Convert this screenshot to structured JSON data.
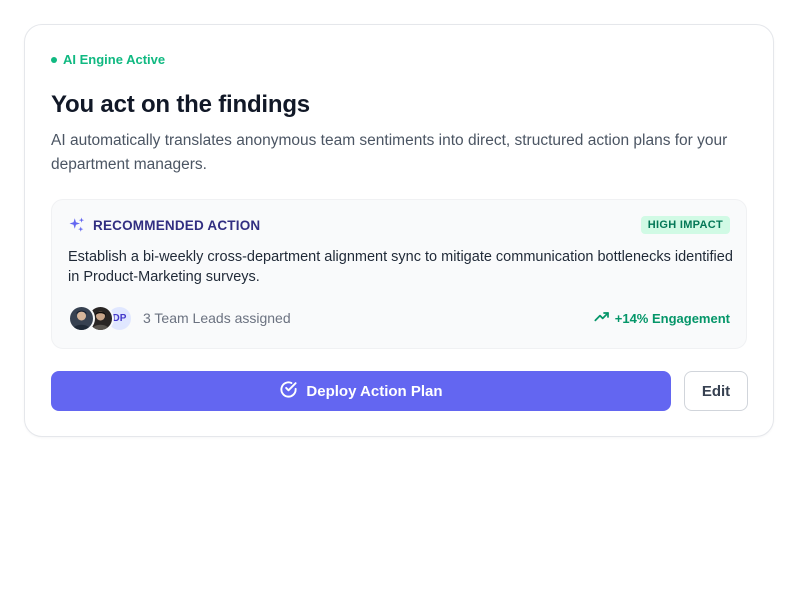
{
  "status": {
    "label": "AI Engine Active",
    "color": "#10b981"
  },
  "heading": {
    "title": "You act on the findings",
    "description": "AI automatically translates anonymous team sentiments into direct, structured action plans for your department managers."
  },
  "recommendation": {
    "label": "RECOMMENDED ACTION",
    "icon": "sparkles-icon",
    "badge": "HIGH IMPACT",
    "text": "Establish a bi-weekly cross-department alignment sync to mitigate communication bottlenecks identified in Product-Marketing surveys.",
    "avatars": [
      {
        "type": "photo",
        "icon": "person-avatar"
      },
      {
        "type": "photo",
        "icon": "person-avatar"
      },
      {
        "type": "initials",
        "initials": "DP"
      }
    ],
    "assigned_text": "3 Team Leads assigned",
    "engagement": "+14% Engagement",
    "engagement_icon": "trending-up-icon"
  },
  "actions": {
    "deploy_label": "Deploy Action Plan",
    "deploy_icon": "check-circle-icon",
    "edit_label": "Edit"
  },
  "colors": {
    "accent": "#6366f1",
    "success": "#10b981",
    "badge_bg": "#d1fae5",
    "heading": "#111827"
  }
}
